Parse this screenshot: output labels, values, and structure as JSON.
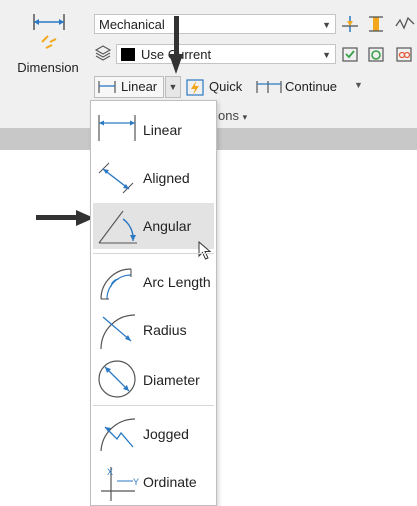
{
  "ribbon": {
    "dimension_label": "Dimension",
    "dimstyle_value": "Mechanical",
    "layer_value": "Use Current",
    "linear_label": "Linear",
    "quick_label": "Quick",
    "continue_label": "Continue",
    "panel_label_partial": "ons",
    "panel_dropdown": "▾",
    "colors": {
      "accent_blue": "#2b79c2",
      "accent_orange": "#f2a81d",
      "ribbon_bg": "#f0f0f0"
    }
  },
  "menu": {
    "items": [
      {
        "label": "Linear",
        "icon": "linear-dim-icon"
      },
      {
        "label": "Aligned",
        "icon": "aligned-dim-icon"
      },
      {
        "label": "Angular",
        "icon": "angular-dim-icon",
        "highlighted": true
      },
      {
        "label": "Arc Length",
        "icon": "arc-length-icon"
      },
      {
        "label": "Radius",
        "icon": "radius-icon"
      },
      {
        "label": "Diameter",
        "icon": "diameter-icon"
      },
      {
        "label": "Jogged",
        "icon": "jogged-icon"
      },
      {
        "label": "Ordinate",
        "icon": "ordinate-icon"
      }
    ]
  }
}
